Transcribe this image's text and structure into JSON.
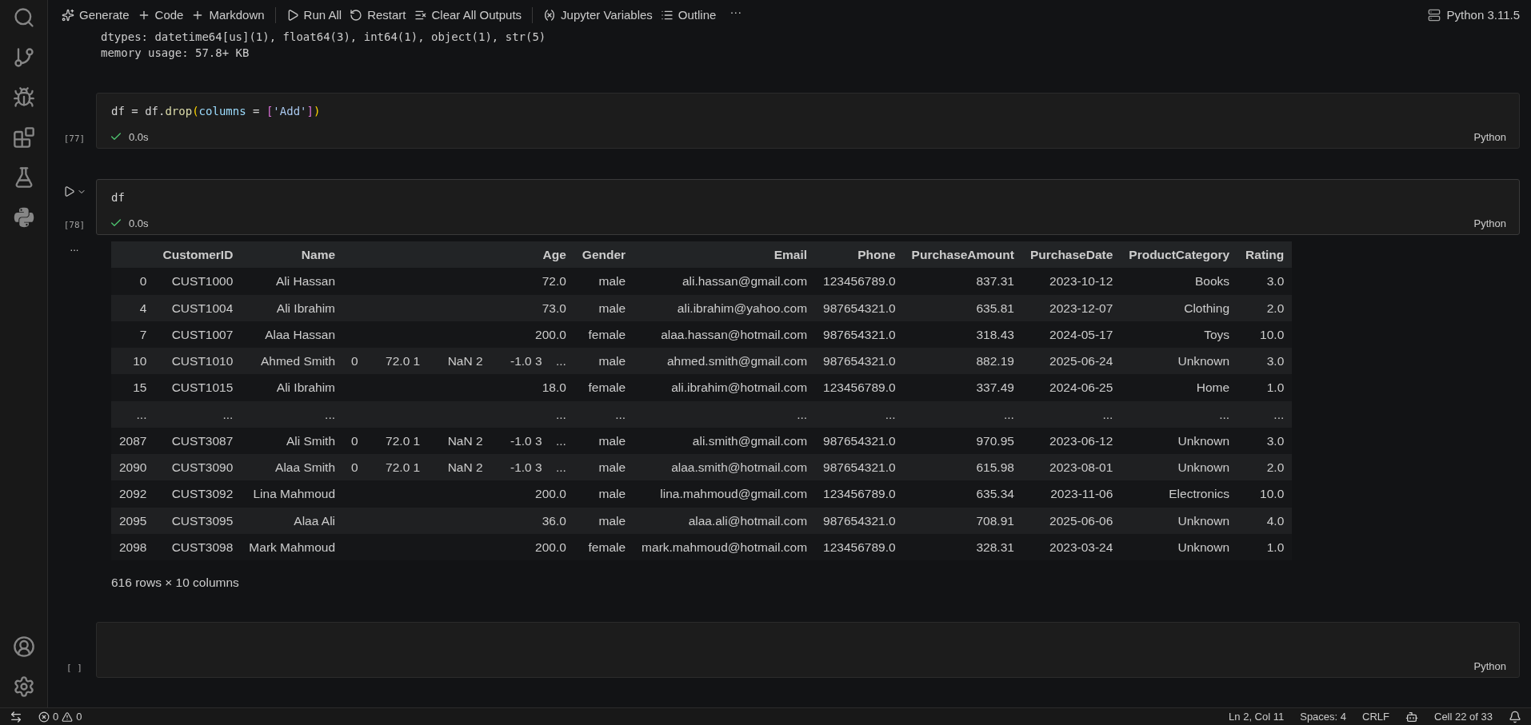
{
  "toolbar": {
    "items": [
      {
        "label": "Generate"
      },
      {
        "label": "Code"
      },
      {
        "label": "Markdown"
      },
      {
        "label": "Run All"
      },
      {
        "label": "Restart"
      },
      {
        "label": "Clear All Outputs"
      },
      {
        "label": "Jupyter Variables"
      },
      {
        "label": "Outline"
      }
    ],
    "more": "···",
    "kernel": "Python 3.11.5"
  },
  "prior_output": [
    "dtypes: datetime64[us](1), float64(3), int64(1), object(1), str(5)",
    "memory usage: 57.8+ KB"
  ],
  "cells": [
    {
      "exec": "[77]",
      "selected": false,
      "tokens": [
        {
          "kind": "plain",
          "text": "df = df."
        },
        {
          "kind": "func",
          "text": "drop"
        },
        {
          "kind": "paren",
          "text": "("
        },
        {
          "kind": "param",
          "text": "columns"
        },
        {
          "kind": "plain",
          "text": " = "
        },
        {
          "kind": "bracket",
          "text": "["
        },
        {
          "kind": "string",
          "text": "'Add'"
        },
        {
          "kind": "bracket",
          "text": "]"
        },
        {
          "kind": "paren",
          "text": ")"
        }
      ],
      "status": "0.0s",
      "succeeded": true,
      "language": "Python"
    },
    {
      "exec": "[78]",
      "selected": true,
      "tokens": [
        {
          "kind": "plain",
          "text": "df"
        }
      ],
      "status": "0.0s",
      "succeeded": true,
      "language": "Python",
      "output_more": "...",
      "table": {
        "columns": [
          "CustomerID",
          "Name",
          "Age",
          "Gender",
          "Email",
          "Phone",
          "PurchaseAmount",
          "PurchaseDate",
          "ProductCategory",
          "Rating"
        ],
        "rows": [
          {
            "index": "0",
            "cells": [
              "CUST1000",
              "Ali Hassan",
              "72.0",
              "male",
              "ali.hassan@gmail.com",
              "123456789.0",
              "837.31",
              "2023-10-12",
              "Books",
              "3.0"
            ]
          },
          {
            "index": "4",
            "cells": [
              "CUST1004",
              "Ali Ibrahim",
              "73.0",
              "male",
              "ali.ibrahim@yahoo.com",
              "987654321.0",
              "635.81",
              "2023-12-07",
              "Clothing",
              "2.0"
            ]
          },
          {
            "index": "7",
            "cells": [
              "CUST1007",
              "Alaa Hassan",
              "200.0",
              "female",
              "alaa.hassan@hotmail.com",
              "987654321.0",
              "318.43",
              "2024-05-17",
              "Toys",
              "10.0"
            ]
          },
          {
            "index": "10",
            "cells": [
              "CUST1010",
              "Ahmed Smith",
              "0        72.0 1        NaN 2        -1.0 3    ...",
              "male",
              "ahmed.smith@gmail.com",
              "987654321.0",
              "882.19",
              "2025-06-24",
              "Unknown",
              "3.0"
            ]
          },
          {
            "index": "15",
            "cells": [
              "CUST1015",
              "Ali Ibrahim",
              "18.0",
              "female",
              "ali.ibrahim@hotmail.com",
              "123456789.0",
              "337.49",
              "2024-06-25",
              "Home",
              "1.0"
            ]
          },
          {
            "index": "...",
            "cells": [
              "...",
              "...",
              "...",
              "...",
              "...",
              "...",
              "...",
              "...",
              "...",
              "..."
            ]
          },
          {
            "index": "2087",
            "cells": [
              "CUST3087",
              "Ali Smith",
              "0        72.0 1        NaN 2        -1.0 3    ...",
              "male",
              "ali.smith@gmail.com",
              "987654321.0",
              "970.95",
              "2023-06-12",
              "Unknown",
              "3.0"
            ]
          },
          {
            "index": "2090",
            "cells": [
              "CUST3090",
              "Alaa Smith",
              "0        72.0 1        NaN 2        -1.0 3    ...",
              "male",
              "alaa.smith@hotmail.com",
              "987654321.0",
              "615.98",
              "2023-08-01",
              "Unknown",
              "2.0"
            ]
          },
          {
            "index": "2092",
            "cells": [
              "CUST3092",
              "Lina Mahmoud",
              "200.0",
              "male",
              "lina.mahmoud@gmail.com",
              "123456789.0",
              "635.34",
              "2023-11-06",
              "Electronics",
              "10.0"
            ]
          },
          {
            "index": "2095",
            "cells": [
              "CUST3095",
              "Alaa Ali",
              "36.0",
              "male",
              "alaa.ali@hotmail.com",
              "987654321.0",
              "708.91",
              "2025-06-06",
              "Unknown",
              "4.0"
            ]
          },
          {
            "index": "2098",
            "cells": [
              "CUST3098",
              "Mark Mahmoud",
              "200.0",
              "female",
              "mark.mahmoud@hotmail.com",
              "123456789.0",
              "328.31",
              "2023-03-24",
              "Unknown",
              "1.0"
            ]
          }
        ],
        "summary": "616 rows × 10 columns"
      }
    },
    {
      "exec": "[ ]",
      "selected": false,
      "language": "Python"
    }
  ],
  "status_bar": {
    "errors": "0",
    "warnings": "0",
    "items": [
      "Ln 2, Col 11",
      "Spaces: 4",
      "CRLF",
      "Cell 22 of 33"
    ]
  }
}
